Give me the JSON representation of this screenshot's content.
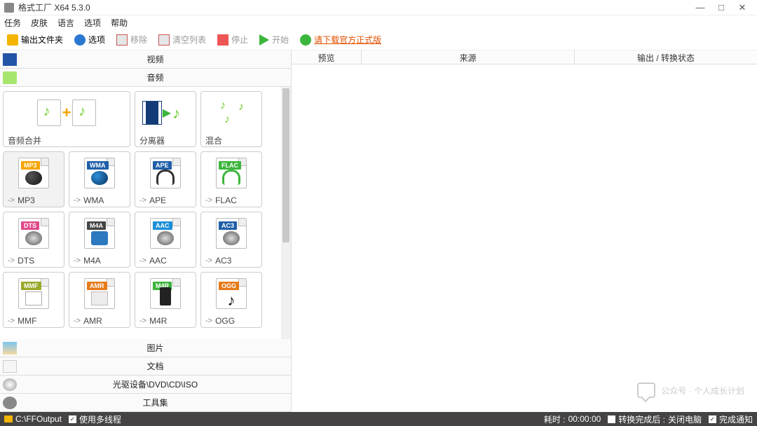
{
  "title": "格式工厂 X64 5.3.0",
  "menu": [
    "任务",
    "皮肤",
    "语言",
    "选项",
    "帮助"
  ],
  "toolbar": {
    "output_folder": "输出文件夹",
    "options": "选项",
    "remove": "移除",
    "clear": "清空列表",
    "stop": "停止",
    "start": "开始",
    "download_link": "请下载官方正式版"
  },
  "categories": {
    "video": "视频",
    "audio": "音频",
    "image": "图片",
    "document": "文档",
    "disc": "光驱设备\\DVD\\CD\\ISO",
    "tools": "工具集"
  },
  "action_tiles": {
    "merge": "音频合并",
    "splitter": "分离器",
    "mix": "混合"
  },
  "formats": [
    {
      "tag": "MP3",
      "label": "MP3",
      "color": "#f5a400",
      "icon": "disc",
      "sel": true
    },
    {
      "tag": "WMA",
      "label": "WMA",
      "color": "#1f5fa8",
      "icon": "disc-blue"
    },
    {
      "tag": "APE",
      "label": "APE",
      "color": "#1f5fa8",
      "icon": "hp"
    },
    {
      "tag": "FLAC",
      "label": "FLAC",
      "color": "#3cb53c",
      "icon": "hp-green"
    },
    {
      "tag": "DTS",
      "label": "DTS",
      "color": "#e04a8a",
      "icon": "speaker"
    },
    {
      "tag": "M4A",
      "label": "M4A",
      "color": "#444",
      "icon": "note"
    },
    {
      "tag": "AAC",
      "label": "AAC",
      "color": "#1a8fd8",
      "icon": "speaker"
    },
    {
      "tag": "AC3",
      "label": "AC3",
      "color": "#1f5fa8",
      "icon": "speaker"
    },
    {
      "tag": "MMF",
      "label": "MMF",
      "color": "#9aa82a",
      "icon": "env"
    },
    {
      "tag": "AMR",
      "label": "AMR",
      "color": "#e67a1a",
      "icon": "sheet"
    },
    {
      "tag": "M4R",
      "label": "M4R",
      "color": "#3cb53c",
      "icon": "phone"
    },
    {
      "tag": "OGG",
      "label": "OGG",
      "color": "#e67a1a",
      "icon": "mnote"
    }
  ],
  "columns": [
    "预览",
    "来源",
    "输出 / 转换状态"
  ],
  "watermark": "公众号 · 个人成长计划",
  "status": {
    "output_path": "C:\\FFOutput",
    "multithread": "使用多线程",
    "elapsed_label": "耗时 :",
    "elapsed_time": "00:00:00",
    "after_label": "转换完成后 :",
    "after_action": "关闭电脑",
    "notify": "完成通知"
  }
}
